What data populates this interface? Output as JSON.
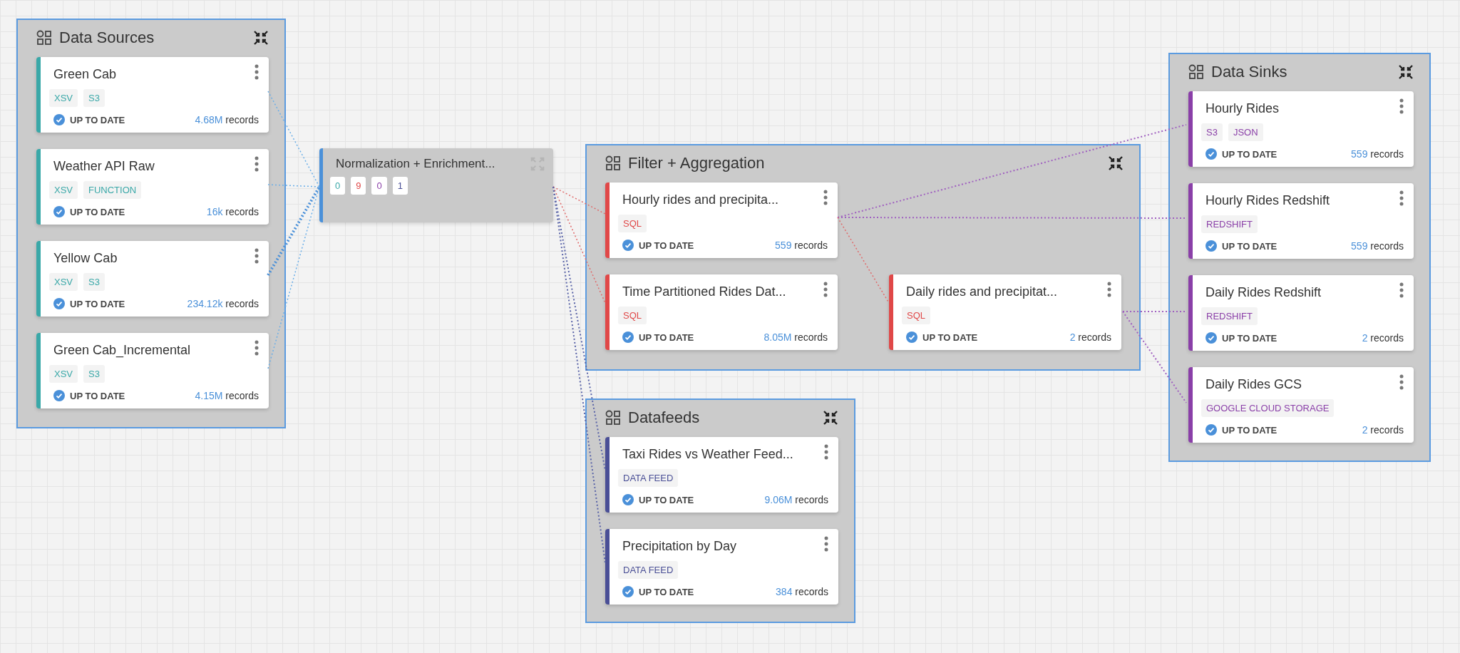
{
  "groups": [
    {
      "title": "Data Sources",
      "kind": "source",
      "nodes": [
        {
          "title": "Green Cab",
          "tags": [
            "XSV",
            "S3"
          ],
          "status": "UP TO DATE",
          "count": "4.68M",
          "unit": "records"
        },
        {
          "title": "Weather API Raw",
          "tags": [
            "XSV",
            "FUNCTION"
          ],
          "status": "UP TO DATE",
          "count": "16k",
          "unit": "records"
        },
        {
          "title": "Yellow Cab",
          "tags": [
            "XSV",
            "S3"
          ],
          "status": "UP TO DATE",
          "count": "234.12k",
          "unit": "records"
        },
        {
          "title": "Green Cab_Incremental",
          "tags": [
            "XSV",
            "S3"
          ],
          "status": "UP TO DATE",
          "count": "4.15M",
          "unit": "records"
        }
      ]
    },
    {
      "title": "Filter + Aggregation",
      "kind": "transform",
      "nodes": [
        {
          "title": "Hourly rides and precipita...",
          "tags": [
            "SQL"
          ],
          "status": "UP TO DATE",
          "count": "559",
          "unit": "records"
        },
        {
          "title": "Time Partitioned Rides Dat...",
          "tags": [
            "SQL"
          ],
          "status": "UP TO DATE",
          "count": "8.05M",
          "unit": "records"
        },
        {
          "title": "Daily rides and precipitat...",
          "tags": [
            "SQL"
          ],
          "status": "UP TO DATE",
          "count": "2",
          "unit": "records"
        }
      ]
    },
    {
      "title": "Datafeeds",
      "kind": "feed",
      "nodes": [
        {
          "title": "Taxi Rides vs Weather Feed...",
          "tags": [
            "DATA FEED"
          ],
          "status": "UP TO DATE",
          "count": "9.06M",
          "unit": "records"
        },
        {
          "title": "Precipitation by Day",
          "tags": [
            "DATA FEED"
          ],
          "status": "UP TO DATE",
          "count": "384",
          "unit": "records"
        }
      ]
    },
    {
      "title": "Data Sinks",
      "kind": "sink",
      "nodes": [
        {
          "title": "Hourly Rides",
          "tags": [
            "S3",
            "JSON"
          ],
          "status": "UP TO DATE",
          "count": "559",
          "unit": "records"
        },
        {
          "title": "Hourly Rides Redshift",
          "tags": [
            "REDSHIFT"
          ],
          "status": "UP TO DATE",
          "count": "559",
          "unit": "records"
        },
        {
          "title": "Daily Rides Redshift",
          "tags": [
            "REDSHIFT"
          ],
          "status": "UP TO DATE",
          "count": "2",
          "unit": "records"
        },
        {
          "title": "Daily Rides GCS",
          "tags": [
            "GOOGLE CLOUD STORAGE"
          ],
          "status": "UP TO DATE",
          "count": "2",
          "unit": "records"
        }
      ]
    }
  ],
  "collapsed_group": {
    "title": "Normalization + Enrichment...",
    "counts": [
      {
        "kind": "source",
        "value": "0"
      },
      {
        "kind": "transform",
        "value": "9"
      },
      {
        "kind": "sink",
        "value": "0"
      },
      {
        "kind": "feed",
        "value": "1"
      }
    ]
  }
}
